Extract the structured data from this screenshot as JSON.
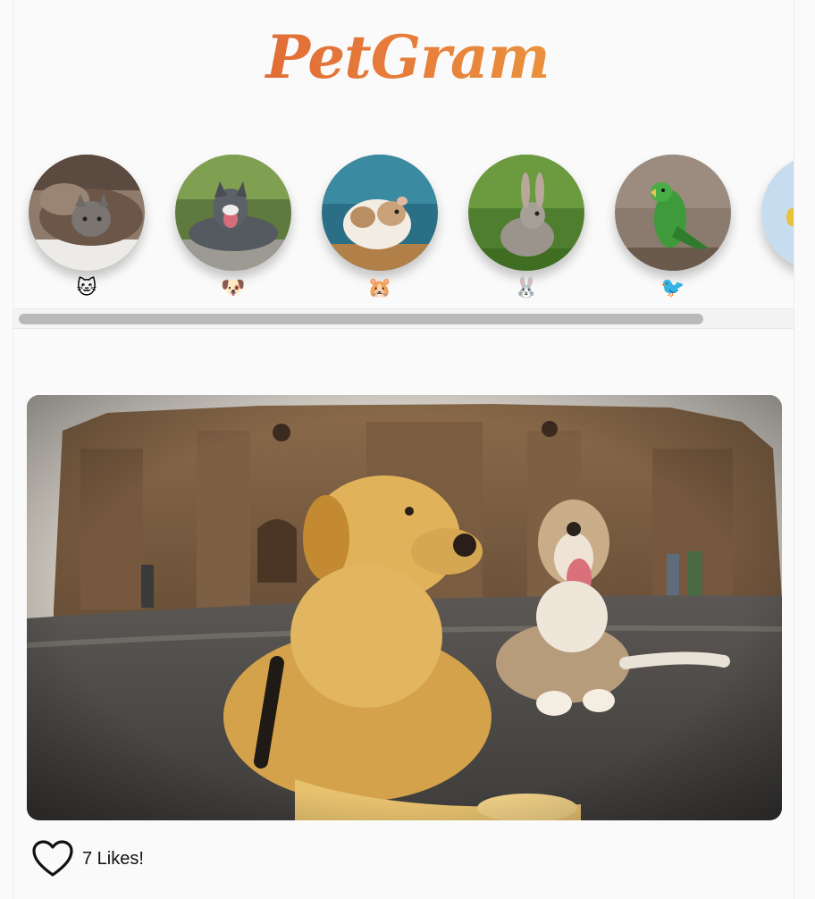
{
  "app": {
    "logo": "PetGram"
  },
  "stories": [
    {
      "emoji": "🐱",
      "icon": "cat-icon"
    },
    {
      "emoji": "🐶",
      "icon": "dog-icon"
    },
    {
      "emoji": "🐹",
      "icon": "hamster-icon"
    },
    {
      "emoji": "🐰",
      "icon": "rabbit-icon"
    },
    {
      "emoji": "🐦",
      "icon": "bird-icon"
    }
  ],
  "post": {
    "likes_text": "7 Likes!",
    "like_icon": "heart-icon"
  },
  "colors": {
    "logo_start": "#d9512c",
    "logo_end": "#f1b540",
    "background": "#fafafa"
  }
}
